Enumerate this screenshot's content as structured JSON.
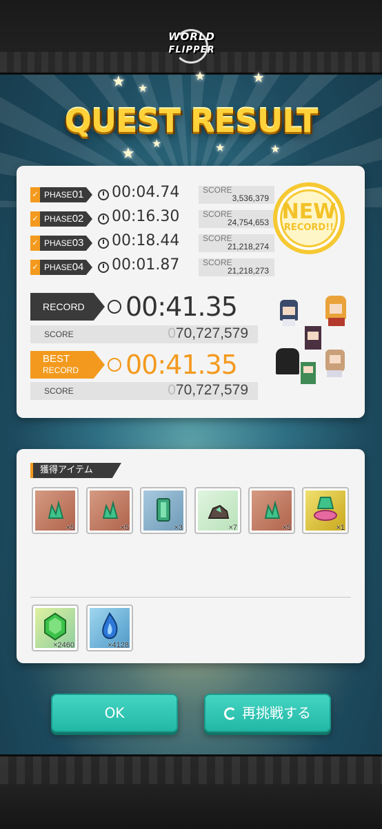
{
  "logo": {
    "line1": "WORLD",
    "line2": "FLIPPER"
  },
  "title": "QUEST RESULT",
  "phases": [
    {
      "tag": "PHASE",
      "num": "01",
      "time": "00:04.74",
      "score_label": "SCORE",
      "score": "3,536,379"
    },
    {
      "tag": "PHASE",
      "num": "02",
      "time": "00:16.30",
      "score_label": "SCORE",
      "score": "24,754,653"
    },
    {
      "tag": "PHASE",
      "num": "03",
      "time": "00:18.44",
      "score_label": "SCORE",
      "score": "21,218,274"
    },
    {
      "tag": "PHASE",
      "num": "04",
      "time": "00:01.87",
      "score_label": "SCORE",
      "score": "21,218,273"
    }
  ],
  "new_record": {
    "line1": "NEW",
    "line2": "RECORD!!"
  },
  "record": {
    "label": "RECORD",
    "time": "00:41.35",
    "score_label": "SCORE",
    "score_prefix": "0",
    "score": "70,727,579"
  },
  "best_record": {
    "label_line1": "BEST",
    "label_line2": "RECORD",
    "time": "00:41.35",
    "score_label": "SCORE",
    "score_prefix": "0",
    "score": "70,727,579"
  },
  "items_header": "獲得アイテム",
  "items": [
    {
      "icon": "green-crystal-icon",
      "qty": "×5",
      "bg": "#c9826a"
    },
    {
      "icon": "green-crystal-icon",
      "qty": "×5",
      "bg": "#c9826a"
    },
    {
      "icon": "green-gem-icon",
      "qty": "×3",
      "bg": "#8db4cc"
    },
    {
      "icon": "ore-icon",
      "qty": "×7",
      "bg": "#cfe9cf"
    },
    {
      "icon": "green-crystal-icon",
      "qty": "×5",
      "bg": "#c9826a"
    },
    {
      "icon": "crystal-hand-icon",
      "qty": "×1",
      "bg": "#e0cb3a"
    }
  ],
  "currencies": [
    {
      "icon": "emerald-gem-icon",
      "qty": "×2460"
    },
    {
      "icon": "blue-flame-icon",
      "qty": "×4128"
    }
  ],
  "buttons": {
    "ok": "OK",
    "retry": "再挑戦する"
  },
  "colors": {
    "accent": "#f39a1e",
    "button": "#2fc3b0",
    "title": "#ffd23a"
  }
}
